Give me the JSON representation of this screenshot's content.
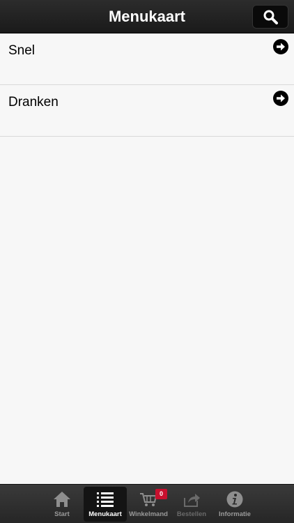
{
  "header": {
    "title": "Menukaart",
    "search_icon": "search-icon"
  },
  "menu": {
    "items": [
      {
        "label": "Snel",
        "icon": "arrow-right-circle-icon"
      },
      {
        "label": "Dranken",
        "icon": "arrow-right-circle-icon"
      }
    ]
  },
  "tabbar": {
    "tabs": [
      {
        "label": "Start",
        "icon": "home-icon"
      },
      {
        "label": "Menukaart",
        "icon": "list-icon",
        "active": true
      },
      {
        "label": "Winkelmand",
        "icon": "cart-icon",
        "badge": "0"
      },
      {
        "label": "Bestellen",
        "icon": "share-icon",
        "disabled": true
      },
      {
        "label": "Informatie",
        "icon": "info-icon"
      }
    ]
  },
  "colors": {
    "badge": "#c8102e",
    "navbar": "#1a1a1a",
    "background": "#f7f7f7"
  }
}
